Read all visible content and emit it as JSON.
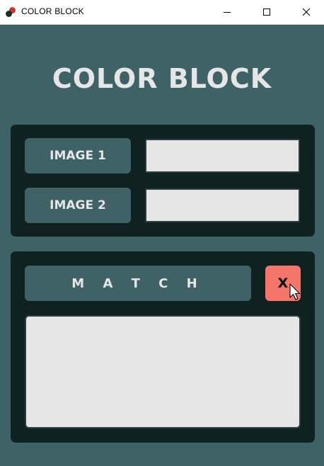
{
  "window": {
    "title": "COLOR BLOCK",
    "icon": "app-dots-icon",
    "controls": [
      "minimize-icon",
      "maximize-icon",
      "close-icon"
    ]
  },
  "app": {
    "heading": "COLOR BLOCK",
    "image_panel": {
      "image1_label": "IMAGE 1",
      "image1_value": "",
      "image2_label": "IMAGE 2",
      "image2_value": ""
    },
    "match_panel": {
      "match_label": "M A T C H",
      "clear_label": "X",
      "result_text": ""
    }
  },
  "colors": {
    "background": "#3f6266",
    "panel": "#102121",
    "field": "#e6e6e6",
    "text": "#e6e6e6",
    "clear_button": "#f6756b"
  }
}
